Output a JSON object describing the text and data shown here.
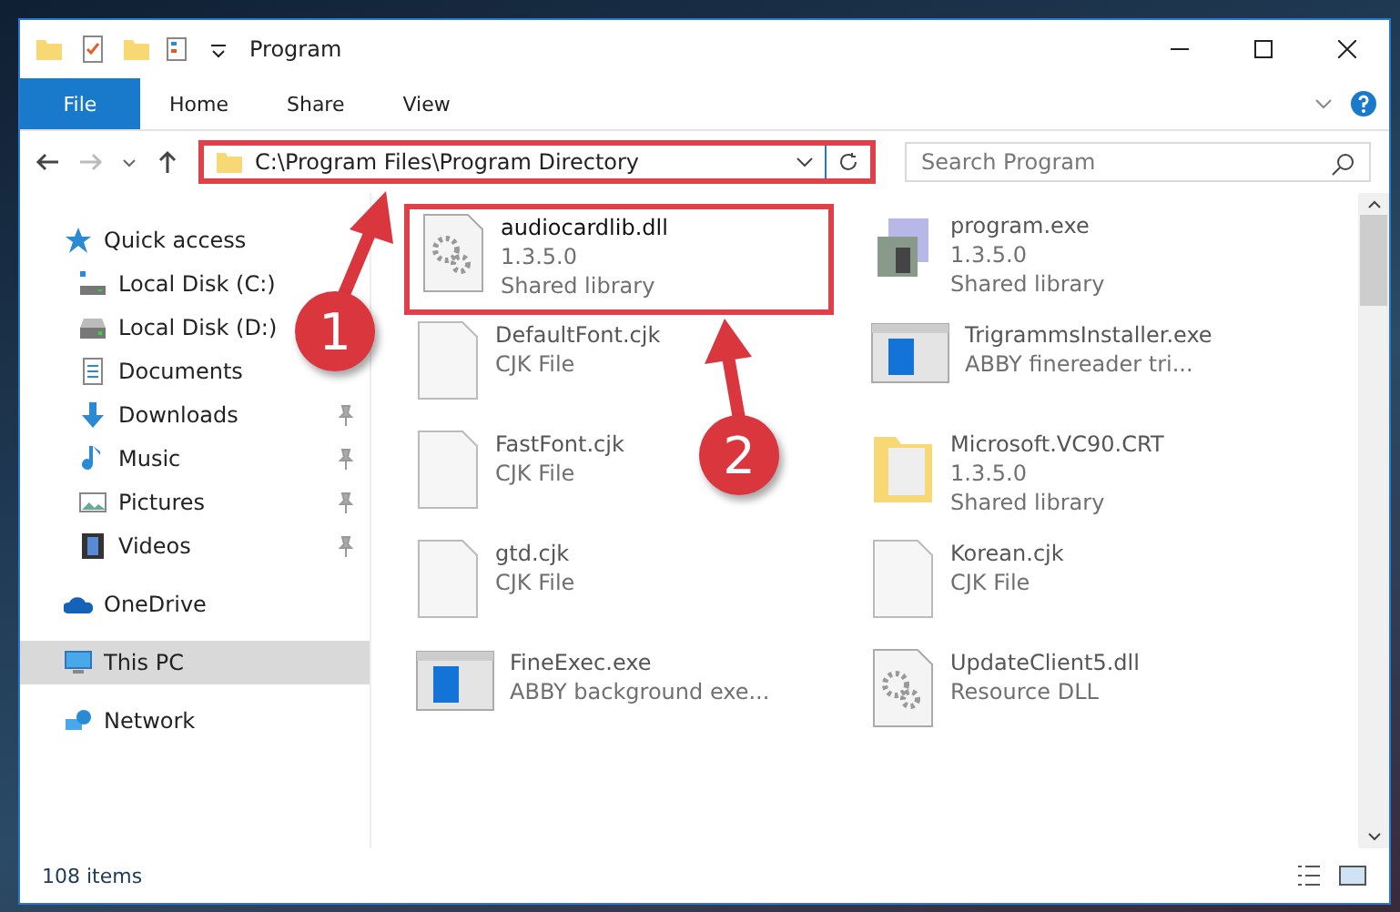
{
  "window": {
    "title": "Program"
  },
  "ribbon": {
    "tabs": [
      {
        "label": "File",
        "selected": true
      },
      {
        "label": "Home",
        "selected": false
      },
      {
        "label": "Share",
        "selected": false
      },
      {
        "label": "View",
        "selected": false
      }
    ]
  },
  "address": {
    "path": "C:\\Program Files\\Program Directory",
    "highlighted": true
  },
  "search": {
    "placeholder": "Search Program"
  },
  "sidebar": {
    "items": [
      {
        "label": "Quick access",
        "kind": "star",
        "pinned": false,
        "selected": false,
        "group": true
      },
      {
        "label": "Local Disk (C:)",
        "kind": "diskc",
        "pinned": false,
        "selected": false,
        "group": false
      },
      {
        "label": "Local Disk (D:)",
        "kind": "disk",
        "pinned": false,
        "selected": false,
        "group": false
      },
      {
        "label": "Documents",
        "kind": "doc",
        "pinned": false,
        "selected": false,
        "group": false
      },
      {
        "label": "Downloads",
        "kind": "down",
        "pinned": true,
        "selected": false,
        "group": false
      },
      {
        "label": "Music",
        "kind": "music",
        "pinned": true,
        "selected": false,
        "group": false
      },
      {
        "label": "Pictures",
        "kind": "pic",
        "pinned": true,
        "selected": false,
        "group": false
      },
      {
        "label": "Videos",
        "kind": "video",
        "pinned": true,
        "selected": false,
        "group": false
      },
      {
        "label": "OneDrive",
        "kind": "cloud",
        "pinned": false,
        "selected": false,
        "group": true
      },
      {
        "label": "This PC",
        "kind": "pc",
        "pinned": false,
        "selected": true,
        "group": true
      },
      {
        "label": "Network",
        "kind": "net",
        "pinned": false,
        "selected": false,
        "group": true
      }
    ]
  },
  "files": [
    {
      "name": "audiocardlib.dll",
      "lines": [
        "1.3.5.0",
        "Shared library"
      ],
      "kind": "dll",
      "highlighted": true
    },
    {
      "name": "program.exe",
      "lines": [
        "1.3.5.0",
        "Shared library"
      ],
      "kind": "setup",
      "highlighted": false
    },
    {
      "name": "DefaultFont.cjk",
      "lines": [
        "CJK File"
      ],
      "kind": "blank",
      "highlighted": false
    },
    {
      "name": "TrigrammsInstaller.exe",
      "lines": [
        "ABBY finereader tri..."
      ],
      "kind": "app",
      "highlighted": false
    },
    {
      "name": "FastFont.cjk",
      "lines": [
        "CJK File"
      ],
      "kind": "blank",
      "highlighted": false
    },
    {
      "name": "Microsoft.VC90.CRT",
      "lines": [
        "1.3.5.0",
        "Shared library"
      ],
      "kind": "folder",
      "highlighted": false
    },
    {
      "name": "gtd.cjk",
      "lines": [
        "CJK File"
      ],
      "kind": "blank",
      "highlighted": false
    },
    {
      "name": "Korean.cjk",
      "lines": [
        "CJK File"
      ],
      "kind": "blank",
      "highlighted": false
    },
    {
      "name": "FineExec.exe",
      "lines": [
        "ABBY background exe..."
      ],
      "kind": "app",
      "highlighted": false
    },
    {
      "name": "UpdateClient5.dll",
      "lines": [
        "Resource DLL"
      ],
      "kind": "dll",
      "highlighted": false
    }
  ],
  "callouts": [
    {
      "number": "1"
    },
    {
      "number": "2"
    }
  ],
  "status_bar": {
    "count": "108 items"
  }
}
